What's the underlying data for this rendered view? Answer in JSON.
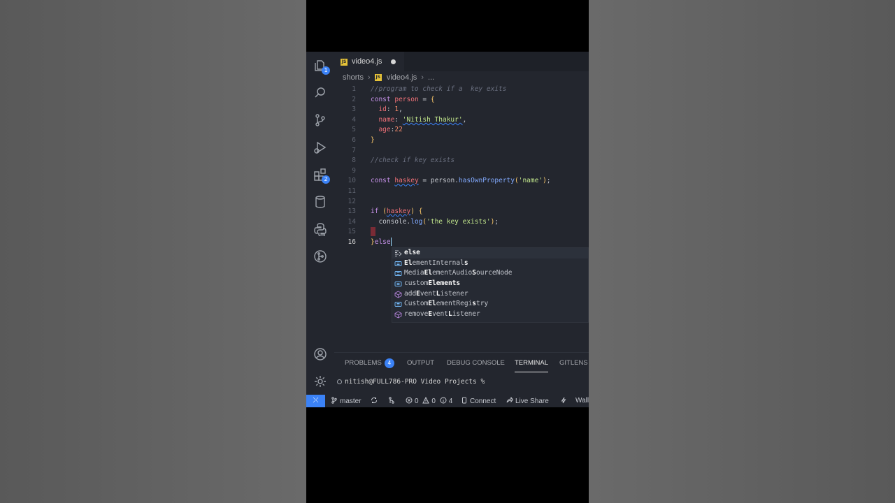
{
  "tab": {
    "name": "video4.js",
    "badge": "JS"
  },
  "breadcrumb": {
    "folder": "shorts",
    "file": "video4.js",
    "more": "..."
  },
  "activity_badges": {
    "explorer": "1",
    "extensions": "2"
  },
  "code": {
    "ln1": "1",
    "ln2": "2",
    "ln3": "3",
    "ln4": "4",
    "ln5": "5",
    "ln6": "6",
    "ln7": "7",
    "ln8": "8",
    "ln9": "9",
    "ln10": "10",
    "ln11": "11",
    "ln12": "12",
    "ln13": "13",
    "ln14": "14",
    "ln15": "15",
    "ln16": "16",
    "l1": "//program to check if a  key exits",
    "l2_kw": "const",
    "l2_id": "person",
    "l2_op": "=",
    "l2_br": "{",
    "l3_key": "id",
    "l3_val": "1",
    "l4_key": "name",
    "l4_val": "'Nitish Thakur'",
    "l5_key": "age",
    "l5_val": "22",
    "l6_br": "}",
    "l8": "//check if key exists",
    "l10_kw": "const",
    "l10_id": "haskey",
    "l10_obj": "person",
    "l10_fn": "hasOwnProperty",
    "l10_arg": "'name'",
    "l13_kw": "if",
    "l13_id": "haskey",
    "l13_br": "{",
    "l14_obj": "console",
    "l14_fn": "log",
    "l14_arg": "'the key exists'",
    "l16_br": "}",
    "l16_kw": "else"
  },
  "suggestions": [
    {
      "pre": "",
      "bold": "else",
      "post": "",
      "icon": "snippet"
    },
    {
      "pre": "",
      "bold": "El",
      "mid": "ementInternal",
      "bold2": "s",
      "post": "",
      "icon": "variable"
    },
    {
      "pre": "Media",
      "bold": "El",
      "mid": "ementAudio",
      "bold2": "S",
      "post": "ourceNode",
      "icon": "variable"
    },
    {
      "pre": "custom",
      "bold": "E",
      "mid": "",
      "bold2": "lements",
      "post": "",
      "icon": "variable"
    },
    {
      "pre": "add",
      "bold": "E",
      "mid": "vent",
      "bold2": "L",
      "post": "istener",
      "icon": "method"
    },
    {
      "pre": "Custom",
      "bold": "El",
      "mid": "ementRegi",
      "bold2": "s",
      "post": "try",
      "icon": "variable"
    },
    {
      "pre": "remove",
      "bold": "E",
      "mid": "vent",
      "bold2": "L",
      "post": "istener",
      "icon": "method"
    }
  ],
  "panel": {
    "problems": "PROBLEMS",
    "problems_count": "4",
    "output": "OUTPUT",
    "debug": "DEBUG CONSOLE",
    "terminal": "TERMINAL",
    "gitlens": "GITLENS",
    "prompt": "nitish@FULL786-PRO Video Projects %"
  },
  "status": {
    "branch": "master",
    "errors": "0",
    "warnings": "0",
    "info": "4",
    "connect": "Connect",
    "liveshare": "Live Share",
    "wall": "Wall"
  },
  "colors": {
    "accent": "#3b82f6",
    "editor_bg": "#23262e"
  }
}
